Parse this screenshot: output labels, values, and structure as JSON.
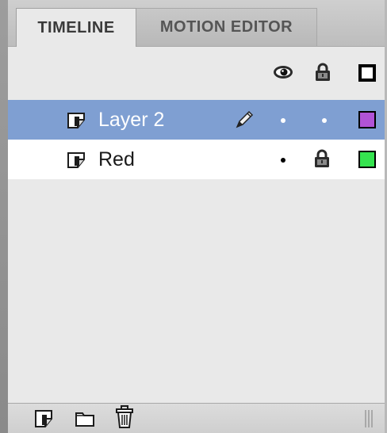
{
  "tabs": [
    {
      "label": "TIMELINE",
      "active": true
    },
    {
      "label": "MOTION EDITOR",
      "active": false
    }
  ],
  "header": {
    "icons": [
      "eye-icon",
      "lock-icon",
      "outline-icon"
    ]
  },
  "layers": [
    {
      "name": "Layer 2",
      "selected": true,
      "editing": true,
      "color": "#b153d6",
      "locked": false
    },
    {
      "name": "Red",
      "selected": false,
      "editing": false,
      "color": "#35e34f",
      "locked": true
    }
  ],
  "bottom_toolbar": {
    "icons": [
      "new-layer-icon",
      "new-folder-icon",
      "delete-layer-icon"
    ]
  },
  "colors": {
    "selected_row": "#7f9fd2",
    "panel_background": "#e9e9e9"
  }
}
